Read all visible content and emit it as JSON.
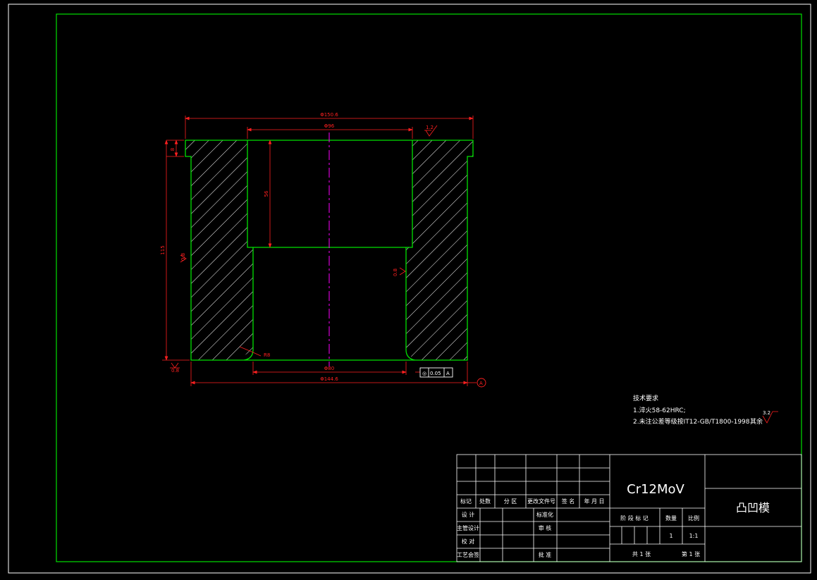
{
  "colors": {
    "background": "#000000",
    "frame": "#ffffff",
    "outline": "#00e000",
    "dimension": "#ff2020",
    "centerline": "#ff00ff",
    "text": "#ffffff"
  },
  "dimensions": {
    "top_outer_dia": "Φ150.6",
    "bore_dia": "Φ96",
    "bottom_inner_dia": "Φ80",
    "bottom_outer_dia": "Φ144.6",
    "flange_height": "8",
    "bore_depth": "56",
    "total_height": "115",
    "surface_rough_top": "1.2",
    "surface_rough_left": "0.8",
    "surface_rough_inner": "0.8",
    "datum_left": "0.8",
    "fillet": "R8"
  },
  "tolerance_frame": {
    "symbol": "◎",
    "value": "0.05",
    "datum": "A"
  },
  "datum_label": "A",
  "tech_requirements": {
    "title": "技术要求",
    "line1": "1.淬火58-62HRC;",
    "line2": "2.未注公差等级按IT12-GB/T1800-1998",
    "others_label": "其余",
    "others_rough": "3.2"
  },
  "title_block": {
    "material": "Cr12MoV",
    "part_name": "凸凹模",
    "headers": [
      "标记",
      "处数",
      "分 区",
      "更改文件号",
      "签 名",
      "年 月 日"
    ],
    "row_labels": [
      "设 计",
      "主管设计",
      "校 对",
      "工艺会签"
    ],
    "mid_labels": [
      "标准化",
      "审 核",
      "批 准"
    ],
    "stage_label": "阶 段 标 记",
    "weight_label": "数量",
    "scale_label": "比例",
    "quantity": "1",
    "scale": "1:1",
    "sheets_total": "共 1 张",
    "sheet_no": "第 1 张"
  }
}
